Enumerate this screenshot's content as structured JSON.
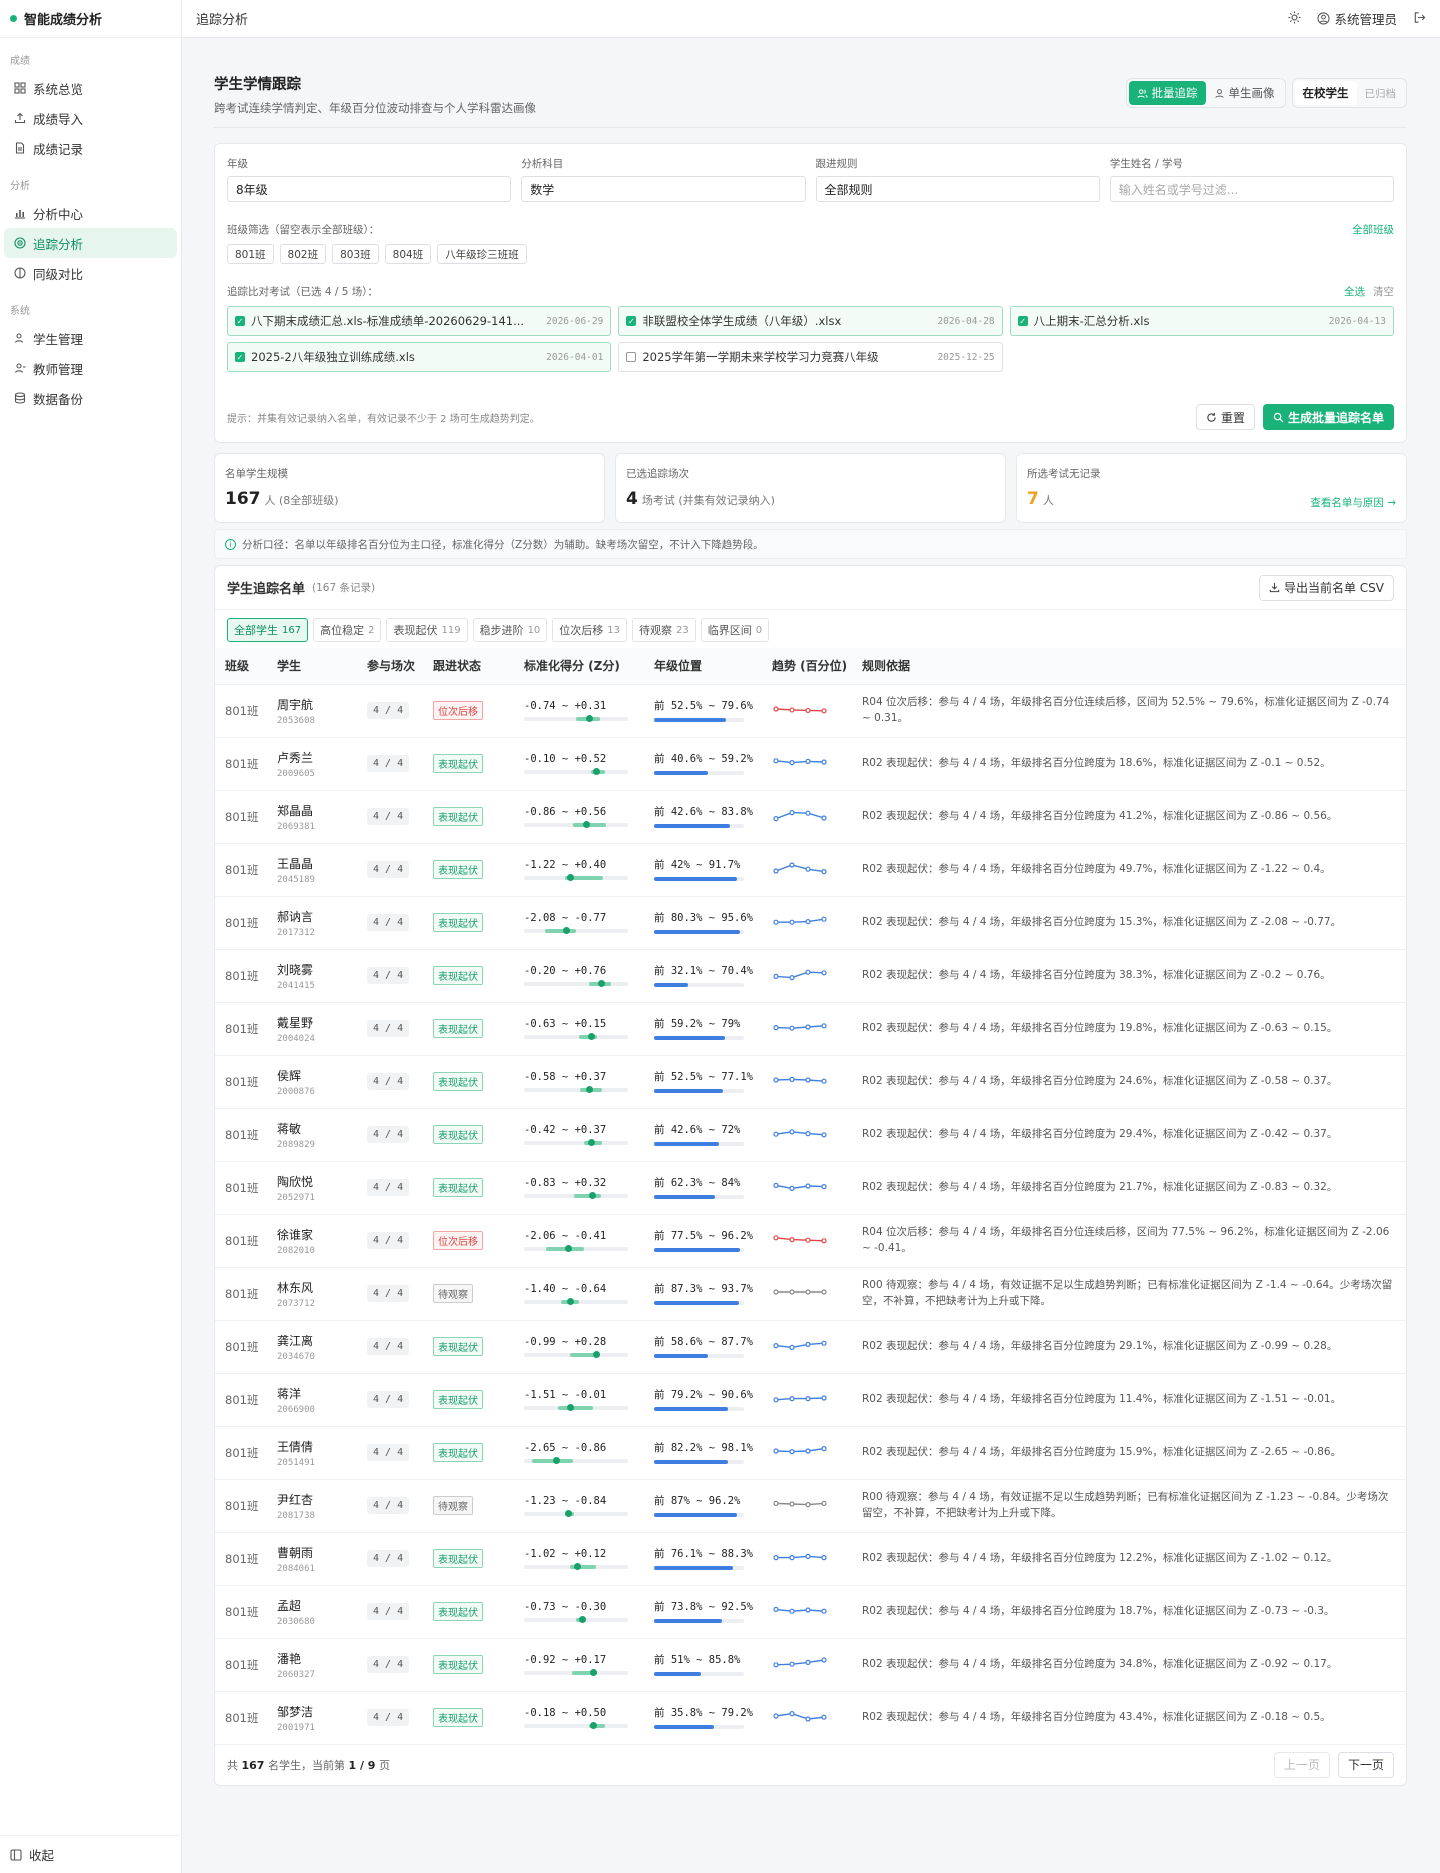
{
  "app": {
    "title": "智能成绩分析"
  },
  "sidebar": {
    "groups": [
      {
        "title": "成绩",
        "items": [
          {
            "label": "系统总览",
            "icon": "grid-icon"
          },
          {
            "label": "成绩导入",
            "icon": "upload-icon"
          },
          {
            "label": "成绩记录",
            "icon": "doc-icon"
          }
        ]
      },
      {
        "title": "分析",
        "items": [
          {
            "label": "分析中心",
            "icon": "chart-icon"
          },
          {
            "label": "追踪分析",
            "icon": "target-icon",
            "active": true
          },
          {
            "label": "同级对比",
            "icon": "compare-icon"
          }
        ]
      },
      {
        "title": "系统",
        "items": [
          {
            "label": "学生管理",
            "icon": "user-icon"
          },
          {
            "label": "教师管理",
            "icon": "teacher-icon"
          },
          {
            "label": "数据备份",
            "icon": "database-icon"
          }
        ]
      }
    ],
    "collapse_label": "收起"
  },
  "topbar": {
    "breadcrumb": "追踪分析",
    "user": "系统管理员"
  },
  "page": {
    "title": "学生学情跟踪",
    "subtitle": "跨考试连续学情判定、年级百分位波动排查与个人学科雷达画像",
    "mode_batch": "批量追踪",
    "mode_single": "单生画像",
    "scope_on": "在校学生",
    "scope_off": "已归档"
  },
  "filters": {
    "grade_label": "年级",
    "grade_value": "8年级",
    "subject_label": "分析科目",
    "subject_value": "数学",
    "rule_label": "跟进规则",
    "rule_value": "全部规则",
    "search_label": "学生姓名 / 学号",
    "search_placeholder": "输入姓名或学号过滤...",
    "class_label": "班级筛选（留空表示全部班级）：",
    "class_all": "全部班级",
    "classes": [
      "801班",
      "802班",
      "803班",
      "804班",
      "八年级珍三班班"
    ],
    "exam_label": "追踪比对考试（已选 4 / 5 场）：",
    "select_all": "全选",
    "clear": "清空",
    "exams": [
      {
        "name": "八下期末成绩汇总.xls-标准成绩单-20260629-141...",
        "date": "2026-06-29",
        "checked": true
      },
      {
        "name": "非联盟校全体学生成绩（八年级）.xlsx",
        "date": "2026-04-28",
        "checked": true
      },
      {
        "name": "八上期末-汇总分析.xls",
        "date": "2026-04-13",
        "checked": true
      },
      {
        "name": "2025-2八年级独立训练成绩.xls",
        "date": "2026-04-01",
        "checked": true
      },
      {
        "name": "2025学年第一学期未来学校学习力竞赛八年级",
        "date": "2025-12-25",
        "checked": false
      }
    ],
    "hint": "提示：并集有效记录纳入名单，有效记录不少于 2 场可生成趋势判定。",
    "reset": "重置",
    "generate": "生成批量追踪名单"
  },
  "stats": [
    {
      "label": "名单学生规模",
      "value": "167",
      "unit": "人 (8全部班级)"
    },
    {
      "label": "已选追踪场次",
      "value": "4",
      "unit": "场考试 (并集有效记录纳入)"
    },
    {
      "label": "所选考试无记录",
      "value": "7",
      "unit": "人",
      "link": "查看名单与原因 →"
    }
  ],
  "notice": "分析口径：名单以年级排名百分位为主口径，标准化得分（Z分数）为辅助。缺考场次留空，不计入下降趋势段。",
  "list": {
    "title": "学生追踪名单",
    "count": "(167 条记录)",
    "export": "导出当前名单 CSV",
    "tabs": [
      {
        "label": "全部学生",
        "n": "167"
      },
      {
        "label": "高位稳定",
        "n": "2"
      },
      {
        "label": "表现起伏",
        "n": "119"
      },
      {
        "label": "稳步进阶",
        "n": "10"
      },
      {
        "label": "位次后移",
        "n": "13"
      },
      {
        "label": "待观察",
        "n": "23"
      },
      {
        "label": "临界区间",
        "n": "0"
      }
    ],
    "columns": [
      "班级",
      "学生",
      "参与场次",
      "跟进状态",
      "标准化得分 (Z分)",
      "年级位置",
      "趋势 (百分位)",
      "规则依据"
    ],
    "rows": [
      {
        "cls": "801班",
        "name": "周宇航",
        "id": "2053608",
        "part": "4 / 4",
        "status": "位次后移",
        "kind": "back",
        "z": "-0.74 ~ +0.31",
        "z1": -0.74,
        "z2": 0.31,
        "zm": -0.2,
        "pos": "前 52.5% ~ 79.6%",
        "pf": 0.8,
        "tr": [
          0.5,
          0.58,
          0.62,
          0.65
        ],
        "rule": "R04 位次后移：参与 4 / 4 场，年级排名百分位连续后移，区间为 52.5% ~ 79.6%，标准化证据区间为 Z -0.74 ~ 0.31。"
      },
      {
        "cls": "801班",
        "name": "卢秀兰",
        "id": "2009605",
        "part": "4 / 4",
        "status": "表现起伏",
        "kind": "up",
        "z": "-0.10 ~ +0.52",
        "z1": -0.1,
        "z2": 0.52,
        "zm": 0.1,
        "pos": "前 40.6% ~ 59.2%",
        "pf": 0.6,
        "tr": [
          0.4,
          0.55,
          0.45,
          0.5
        ],
        "rule": "R02 表现起伏：参与 4 / 4 场，年级排名百分位跨度为 18.6%，标准化证据区间为 Z -0.1 ~ 0.52。"
      },
      {
        "cls": "801班",
        "name": "郑晶晶",
        "id": "2069381",
        "part": "4 / 4",
        "status": "表现起伏",
        "kind": "up",
        "z": "-0.86 ~ +0.56",
        "z1": -0.86,
        "z2": 0.56,
        "zm": -0.3,
        "pos": "前 42.6% ~ 83.8%",
        "pf": 0.84,
        "tr": [
          0.8,
          0.3,
          0.35,
          0.75
        ],
        "rule": "R02 表现起伏：参与 4 / 4 场，年级排名百分位跨度为 41.2%，标准化证据区间为 Z -0.86 ~ 0.56。"
      },
      {
        "cls": "801班",
        "name": "王晶晶",
        "id": "2045189",
        "part": "4 / 4",
        "status": "表现起伏",
        "kind": "up",
        "z": "-1.22 ~ +0.40",
        "z1": -1.22,
        "z2": 0.4,
        "zm": -1.0,
        "pos": "前 42% ~ 91.7%",
        "pf": 0.92,
        "tr": [
          0.75,
          0.25,
          0.6,
          0.8
        ],
        "rule": "R02 表现起伏：参与 4 / 4 场，年级排名百分位跨度为 49.7%，标准化证据区间为 Z -1.22 ~ 0.4。"
      },
      {
        "cls": "801班",
        "name": "郝讷言",
        "id": "2017312",
        "part": "4 / 4",
        "status": "表现起伏",
        "kind": "up",
        "z": "-2.08 ~ -0.77",
        "z1": -2.08,
        "z2": -0.77,
        "zm": -1.2,
        "pos": "前 80.3% ~ 95.6%",
        "pf": 0.95,
        "tr": [
          0.6,
          0.6,
          0.55,
          0.35
        ],
        "rule": "R02 表现起伏：参与 4 / 4 场，年级排名百分位跨度为 15.3%，标准化证据区间为 Z -2.08 ~ -0.77。"
      },
      {
        "cls": "801班",
        "name": "刘晓雾",
        "id": "2041415",
        "part": "4 / 4",
        "status": "表现起伏",
        "kind": "up",
        "z": "-0.20 ~ +0.76",
        "z1": -0.2,
        "z2": 0.76,
        "zm": 0.35,
        "pos": "前 32.1% ~ 70.4%",
        "pf": 0.38,
        "tr": [
          0.7,
          0.8,
          0.35,
          0.4
        ],
        "rule": "R02 表现起伏：参与 4 / 4 场，年级排名百分位跨度为 38.3%，标准化证据区间为 Z -0.2 ~ 0.76。"
      },
      {
        "cls": "801班",
        "name": "戴星野",
        "id": "2004024",
        "part": "4 / 4",
        "status": "表现起伏",
        "kind": "up",
        "z": "-0.63 ~ +0.15",
        "z1": -0.63,
        "z2": 0.15,
        "zm": -0.1,
        "pos": "前 59.2% ~ 79%",
        "pf": 0.79,
        "tr": [
          0.55,
          0.6,
          0.5,
          0.4
        ],
        "rule": "R02 表现起伏：参与 4 / 4 场，年级排名百分位跨度为 19.8%，标准化证据区间为 Z -0.63 ~ 0.15。"
      },
      {
        "cls": "801班",
        "name": "侯辉",
        "id": "2000876",
        "part": "4 / 4",
        "status": "表现起伏",
        "kind": "up",
        "z": "-0.58 ~ +0.37",
        "z1": -0.58,
        "z2": 0.37,
        "zm": -0.2,
        "pos": "前 52.5% ~ 77.1%",
        "pf": 0.77,
        "tr": [
          0.5,
          0.45,
          0.5,
          0.6
        ],
        "rule": "R02 表现起伏：参与 4 / 4 场，年级排名百分位跨度为 24.6%，标准化证据区间为 Z -0.58 ~ 0.37。"
      },
      {
        "cls": "801班",
        "name": "蒋敏",
        "id": "2089829",
        "part": "4 / 4",
        "status": "表现起伏",
        "kind": "up",
        "z": "-0.42 ~ +0.37",
        "z1": -0.42,
        "z2": 0.37,
        "zm": -0.1,
        "pos": "前 42.6% ~ 72%",
        "pf": 0.72,
        "tr": [
          0.6,
          0.4,
          0.55,
          0.65
        ],
        "rule": "R02 表现起伏：参与 4 / 4 场，年级排名百分位跨度为 29.4%，标准化证据区间为 Z -0.42 ~ 0.37。"
      },
      {
        "cls": "801班",
        "name": "陶欣悦",
        "id": "2052971",
        "part": "4 / 4",
        "status": "表现起伏",
        "kind": "up",
        "z": "-0.83 ~ +0.32",
        "z1": -0.83,
        "z2": 0.32,
        "zm": -0.05,
        "pos": "前 62.3% ~ 84%",
        "pf": 0.68,
        "tr": [
          0.45,
          0.7,
          0.5,
          0.55
        ],
        "rule": "R02 表现起伏：参与 4 / 4 场，年级排名百分位跨度为 21.7%，标准化证据区间为 Z -0.83 ~ 0.32。"
      },
      {
        "cls": "801班",
        "name": "徐谁家",
        "id": "2082010",
        "part": "4 / 4",
        "status": "位次后移",
        "kind": "back",
        "z": "-2.06 ~ -0.41",
        "z1": -2.06,
        "z2": -0.41,
        "zm": -1.1,
        "pos": "前 77.5% ~ 96.2%",
        "pf": 0.96,
        "tr": [
          0.4,
          0.55,
          0.6,
          0.65
        ],
        "rule": "R04 位次后移：参与 4 / 4 场，年级排名百分位连续后移，区间为 77.5% ~ 96.2%，标准化证据区间为 Z -2.06 ~ -0.41。"
      },
      {
        "cls": "801班",
        "name": "林东风",
        "id": "2073712",
        "part": "4 / 4",
        "status": "待观察",
        "kind": "watch",
        "z": "-1.40 ~ -0.64",
        "z1": -1.4,
        "z2": -0.64,
        "zm": -1.0,
        "pos": "前 87.3% ~ 93.7%",
        "pf": 0.94,
        "tr": [
          0.5,
          0.5,
          0.5,
          0.5
        ],
        "rule": "R00 待观察：参与 4 / 4 场，有效证据不足以生成趋势判断；已有标准化证据区间为 Z -1.4 ~ -0.64。少考场次留空，不补算，不把缺考计为上升或下降。"
      },
      {
        "cls": "801班",
        "name": "龚江离",
        "id": "2034670",
        "part": "4 / 4",
        "status": "表现起伏",
        "kind": "up",
        "z": "-0.99 ~ +0.28",
        "z1": -0.99,
        "z2": 0.28,
        "zm": 0.1,
        "pos": "前 58.6% ~ 87.7%",
        "pf": 0.6,
        "tr": [
          0.55,
          0.7,
          0.45,
          0.35
        ],
        "rule": "R02 表现起伏：参与 4 / 4 场，年级排名百分位跨度为 29.1%，标准化证据区间为 Z -0.99 ~ 0.28。"
      },
      {
        "cls": "801班",
        "name": "蒋洋",
        "id": "2066900",
        "part": "4 / 4",
        "status": "表现起伏",
        "kind": "up",
        "z": "-1.51 ~ -0.01",
        "z1": -1.51,
        "z2": -0.01,
        "zm": -1.0,
        "pos": "前 79.2% ~ 90.6%",
        "pf": 0.82,
        "tr": [
          0.65,
          0.55,
          0.55,
          0.5
        ],
        "rule": "R02 表现起伏：参与 4 / 4 场，年级排名百分位跨度为 11.4%，标准化证据区间为 Z -1.51 ~ -0.01。"
      },
      {
        "cls": "801班",
        "name": "王倩倩",
        "id": "2051491",
        "part": "4 / 4",
        "status": "表现起伏",
        "kind": "up",
        "z": "-2.65 ~ -0.86",
        "z1": -2.65,
        "z2": -0.86,
        "zm": -1.6,
        "pos": "前 82.2% ~ 98.1%",
        "pf": 0.82,
        "tr": [
          0.5,
          0.55,
          0.5,
          0.3
        ],
        "rule": "R02 表现起伏：参与 4 / 4 场，年级排名百分位跨度为 15.9%，标准化证据区间为 Z -2.65 ~ -0.86。"
      },
      {
        "cls": "801班",
        "name": "尹红杏",
        "id": "2081738",
        "part": "4 / 4",
        "status": "待观察",
        "kind": "watch",
        "z": "-1.23 ~ -0.84",
        "z1": -1.23,
        "z2": -0.84,
        "zm": -1.1,
        "pos": "前 87% ~ 96.2%",
        "pf": 0.92,
        "tr": [
          0.45,
          0.5,
          0.55,
          0.45
        ],
        "rule": "R00 待观察：参与 4 / 4 场，有效证据不足以生成趋势判断；已有标准化证据区间为 Z -1.23 ~ -0.84。少考场次留空，不补算，不把缺考计为上升或下降。"
      },
      {
        "cls": "801班",
        "name": "曹朝雨",
        "id": "2084061",
        "part": "4 / 4",
        "status": "表现起伏",
        "kind": "up",
        "z": "-1.02 ~ +0.12",
        "z1": -1.02,
        "z2": 0.12,
        "zm": -0.7,
        "pos": "前 76.1% ~ 88.3%",
        "pf": 0.88,
        "tr": [
          0.55,
          0.55,
          0.45,
          0.55
        ],
        "rule": "R02 表现起伏：参与 4 / 4 场，年级排名百分位跨度为 12.2%，标准化证据区间为 Z -1.02 ~ 0.12。"
      },
      {
        "cls": "801班",
        "name": "孟超",
        "id": "2030680",
        "part": "4 / 4",
        "status": "表现起伏",
        "kind": "up",
        "z": "-0.73 ~ -0.30",
        "z1": -0.73,
        "z2": -0.3,
        "zm": -0.5,
        "pos": "前 73.8% ~ 92.5%",
        "pf": 0.76,
        "tr": [
          0.45,
          0.6,
          0.5,
          0.6
        ],
        "rule": "R02 表现起伏：参与 4 / 4 场，年级排名百分位跨度为 18.7%，标准化证据区间为 Z -0.73 ~ -0.3。"
      },
      {
        "cls": "801班",
        "name": "潘艳",
        "id": "2060327",
        "part": "4 / 4",
        "status": "表现起伏",
        "kind": "up",
        "z": "-0.92 ~ +0.17",
        "z1": -0.92,
        "z2": 0.17,
        "zm": 0.0,
        "pos": "前 51% ~ 85.8%",
        "pf": 0.52,
        "tr": [
          0.65,
          0.6,
          0.45,
          0.25
        ],
        "rule": "R02 表现起伏：参与 4 / 4 场，年级排名百分位跨度为 34.8%，标准化证据区间为 Z -0.92 ~ 0.17。"
      },
      {
        "cls": "801班",
        "name": "邹梦洁",
        "id": "2001971",
        "part": "4 / 4",
        "status": "表现起伏",
        "kind": "up",
        "z": "-0.18 ~ +0.50",
        "z1": -0.18,
        "z2": 0.5,
        "zm": 0.0,
        "pos": "前 35.8% ~ 79.2%",
        "pf": 0.67,
        "tr": [
          0.5,
          0.3,
          0.75,
          0.6
        ],
        "rule": "R02 表现起伏：参与 4 / 4 场，年级排名百分位跨度为 43.4%，标准化证据区间为 Z -0.18 ~ 0.5。"
      }
    ],
    "pager_text_a": "共",
    "pager_total": "167",
    "pager_text_b": "名学生，当前第",
    "pager_page": "1 / 9",
    "pager_text_c": "页",
    "prev": "上一页",
    "next": "下一页"
  },
  "colors": {
    "accent": "#19b37a",
    "back": "#e04545",
    "trend": "#3e7ee0",
    "watch": "#888888"
  }
}
